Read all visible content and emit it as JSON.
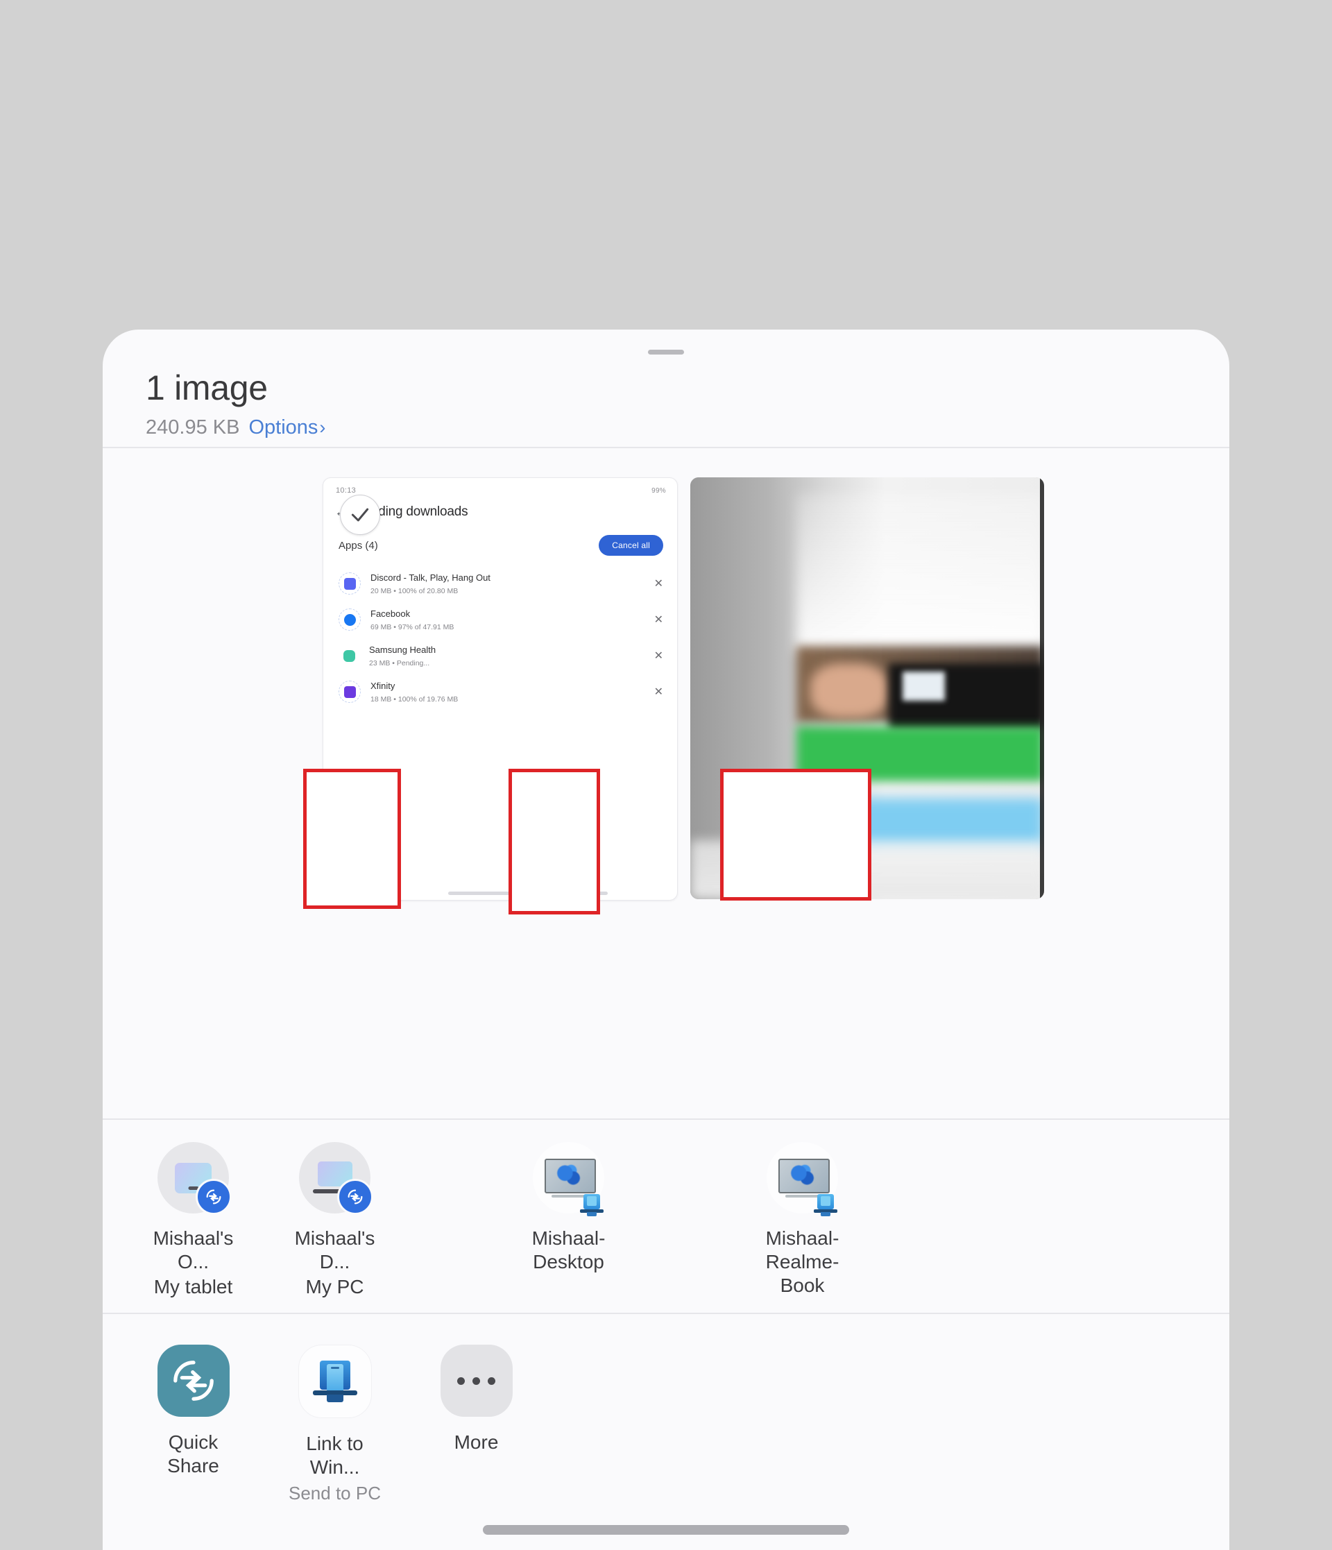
{
  "sheet": {
    "title": "1 image",
    "size": "240.95 KB",
    "options_label": "Options",
    "options_chevron": "›",
    "drag_handle": "drag-handle"
  },
  "preview": {
    "selected_badge_icon": "check-icon",
    "screenshot_thumb": {
      "status_time": "10:13",
      "status_right": "99%",
      "back_icon": "back-arrow-icon",
      "app_title": "Pending downloads",
      "section_label": "Apps (4)",
      "cancel_all_label": "Cancel all",
      "apps": [
        {
          "name": "Discord - Talk, Play, Hang Out",
          "meta": "20 MB • 100% of 20.80 MB",
          "icon": "discord-icon",
          "dismiss_icon": "close-icon"
        },
        {
          "name": "Facebook",
          "meta": "69 MB • 97% of 47.91 MB",
          "icon": "facebook-icon",
          "dismiss_icon": "close-icon"
        },
        {
          "name": "Samsung Health",
          "meta": "23 MB • Pending...",
          "icon": "samsung-health-icon",
          "dismiss_icon": "close-icon"
        },
        {
          "name": "Xfinity",
          "meta": "18 MB • 100% of 19.76 MB",
          "icon": "xfinity-icon",
          "dismiss_icon": "close-icon"
        }
      ]
    },
    "photo_thumb": {
      "alt": "blurred-photo"
    }
  },
  "devices": [
    {
      "name": "Mishaal's O...",
      "sub": "My tablet",
      "icon": "tablet-icon",
      "badge": "quick-share-badge"
    },
    {
      "name": "Mishaal's D...",
      "sub": "My PC",
      "icon": "laptop-icon",
      "badge": "quick-share-badge"
    },
    {
      "name": "Mishaal-Desktop",
      "sub": "",
      "icon": "windows-monitor-icon",
      "badge": "link-to-windows-badge"
    },
    {
      "name": "Mishaal-Realme-Book",
      "sub": "",
      "icon": "windows-monitor-icon",
      "badge": "link-to-windows-badge"
    }
  ],
  "apps": [
    {
      "name": "Quick Share",
      "sub": "",
      "icon": "quick-share-icon"
    },
    {
      "name": "Link to Win...",
      "sub": "Send to PC",
      "icon": "link-to-windows-icon"
    },
    {
      "name": "More",
      "sub": "",
      "icon": "more-dots-icon"
    }
  ],
  "annotations": [
    {
      "id": "redaction-box-1"
    },
    {
      "id": "redaction-box-2"
    },
    {
      "id": "redaction-box-3"
    }
  ],
  "colors": {
    "accent_blue": "#2f6ede",
    "link_blue": "#4a7fd4",
    "annotation_red": "#de2326",
    "quick_share_teal": "#4e92a5",
    "sheet_bg": "#fafafc",
    "page_bg": "#d2d2d2"
  },
  "home_indicator": "home-indicator"
}
